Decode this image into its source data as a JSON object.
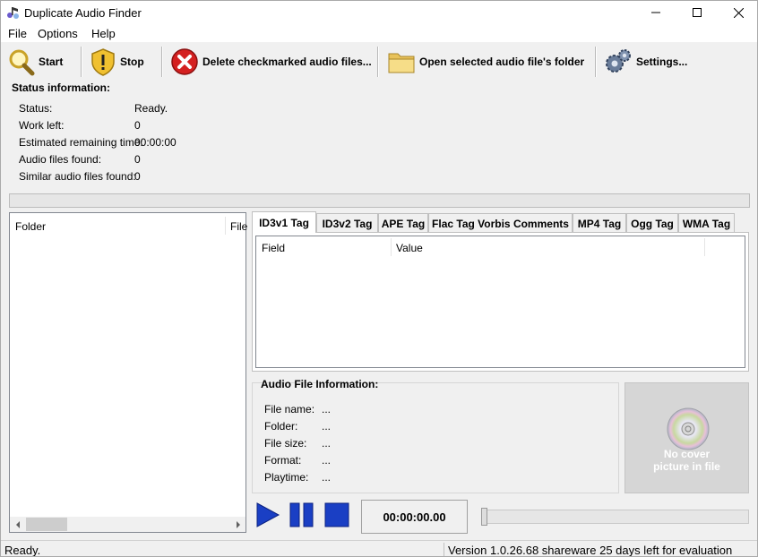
{
  "window": {
    "title": "Duplicate Audio Finder",
    "minimize_glyph": "—",
    "maximize_glyph": "☐",
    "close_glyph": "✕"
  },
  "menu": {
    "file": "File",
    "options": "Options",
    "help": "Help"
  },
  "toolbar": {
    "start": "Start",
    "stop": "Stop",
    "delete": "Delete checkmarked audio files...",
    "open_folder": "Open selected audio file's folder",
    "settings": "Settings..."
  },
  "status": {
    "title": "Status information:",
    "rows": [
      {
        "label": "Status:",
        "value": "Ready."
      },
      {
        "label": "Work left:",
        "value": "0"
      },
      {
        "label": "Estimated remaining time:",
        "value": "00:00:00"
      },
      {
        "label": "Audio files found:",
        "value": "0"
      },
      {
        "label": "Similar audio files found:",
        "value": "0"
      }
    ]
  },
  "file_list": {
    "col_folder": "Folder",
    "col_file": "File"
  },
  "tag_tabs": {
    "tabs": [
      "ID3v1 Tag",
      "ID3v2 Tag",
      "APE Tag",
      "Flac Tag Vorbis Comments",
      "MP4 Tag",
      "Ogg Tag",
      "WMA Tag"
    ],
    "active": 0,
    "col_field": "Field",
    "col_value": "Value"
  },
  "audio_info": {
    "title": "Audio File Information:",
    "rows": [
      {
        "label": "File name:",
        "value": "..."
      },
      {
        "label": "Folder:",
        "value": "..."
      },
      {
        "label": "File size:",
        "value": "..."
      },
      {
        "label": "Format:",
        "value": "..."
      },
      {
        "label": "Playtime:",
        "value": "..."
      }
    ]
  },
  "cover": {
    "line1": "No cover",
    "line2": "picture in file"
  },
  "player": {
    "time": "00:00:00.00",
    "seek_position": 0
  },
  "statusbar": {
    "left": "Ready.",
    "right": "Version 1.0.26.68 shareware 25 days left for evaluation"
  },
  "colors": {
    "accent_blue": "#1a3fc4",
    "delete_red": "#d42020",
    "folder_yellow": "#f3d36a"
  }
}
